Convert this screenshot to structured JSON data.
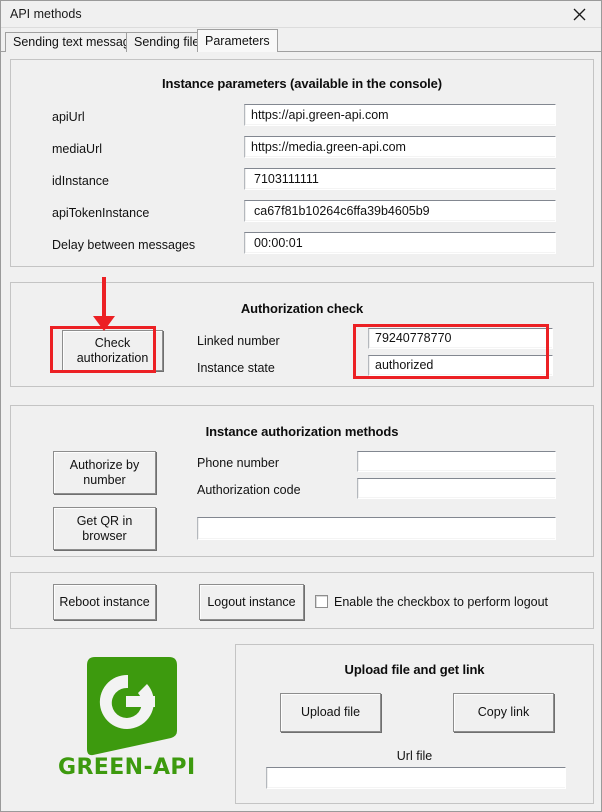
{
  "window": {
    "title": "API methods",
    "close_icon": "close-icon"
  },
  "tabs": [
    {
      "label": "Sending text messages",
      "selected": false
    },
    {
      "label": "Sending files",
      "selected": false
    },
    {
      "label": "Parameters",
      "selected": true
    }
  ],
  "instance_parameters": {
    "title": "Instance parameters (available in the console)",
    "fields": [
      {
        "label": "apiUrl",
        "value": "https://api.green-api.com"
      },
      {
        "label": "mediaUrl",
        "value": "https://media.green-api.com"
      },
      {
        "label": "idInstance",
        "value": "7103111111"
      },
      {
        "label": "apiTokenInstance",
        "value": "ca67f81b10264c6ffa39b4605b9"
      },
      {
        "label": "Delay between messages",
        "value": "00:00:01"
      }
    ]
  },
  "authorization_check": {
    "title": "Authorization check",
    "check_button": "Check authorization",
    "linked_number_label": "Linked number",
    "linked_number_value": "79240778770",
    "instance_state_label": "Instance state",
    "instance_state_value": "authorized"
  },
  "authorization_methods": {
    "title": "Instance authorization methods",
    "authorize_by_number_button": "Authorize by number",
    "get_qr_button": "Get QR in browser",
    "phone_number_label": "Phone number",
    "phone_number_value": "",
    "authorization_code_label": "Authorization code",
    "authorization_code_value": "",
    "qr_value": ""
  },
  "instance_actions": {
    "reboot_button": "Reboot instance",
    "logout_button": "Logout instance",
    "logout_checkbox_label": "Enable the checkbox to perform logout",
    "logout_checkbox_checked": false
  },
  "branding": {
    "wordmark": "GREEN-API",
    "mark_letter": "G",
    "green": "#3d9a0e"
  },
  "upload": {
    "title": "Upload file and get link",
    "upload_button": "Upload file",
    "copy_link_button": "Copy link",
    "url_label": "Url file",
    "url_value": ""
  },
  "annotations": {
    "accent_red": "#ec2024"
  }
}
